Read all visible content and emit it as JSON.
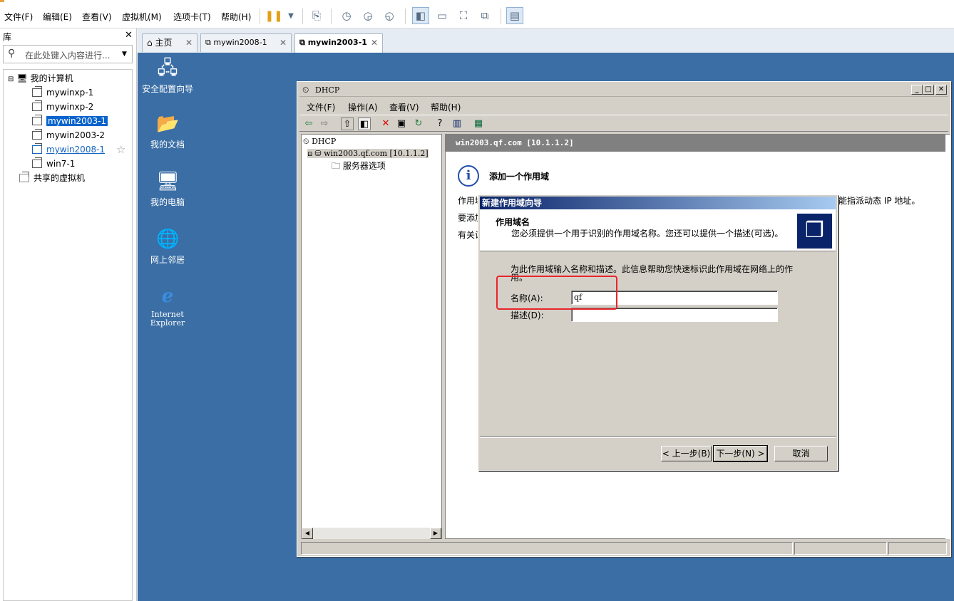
{
  "host": {
    "menu": [
      "文件(F)",
      "编辑(E)",
      "查看(V)",
      "虚拟机(M)",
      "选项卡(T)",
      "帮助(H)"
    ],
    "toolbar_icons": [
      "pause-icon",
      "dropdown-icon",
      "send-keys-icon",
      "snapshot-icon",
      "revert-snapshot-icon",
      "snapshot-manager-icon",
      "sidebar-toggle-icon",
      "console-view-icon",
      "fullscreen-icon",
      "unity-icon",
      "library-view-icon"
    ]
  },
  "library": {
    "title": "库",
    "search_placeholder": "在此处键入内容进行...",
    "root": "我的计算机",
    "vms": [
      "mywinxp-1",
      "mywinxp-2",
      "mywin2003-1",
      "mywin2003-2",
      "mywin2008-1",
      "win7-1"
    ],
    "selected": "mywin2003-1",
    "shared": "共享的虚拟机"
  },
  "tabs": [
    {
      "label": "主页"
    },
    {
      "label": "mywin2008-1"
    },
    {
      "label": "mywin2003-1"
    }
  ],
  "desktop": {
    "icons": [
      "安全配置向导",
      "我的文档",
      "我的电脑",
      "网上邻居",
      "Internet Explorer"
    ],
    "ie_line1": "Internet",
    "ie_line2": "Explorer"
  },
  "mmc": {
    "title": "DHCP",
    "menu": [
      "文件(F)",
      "操作(A)",
      "查看(V)",
      "帮助(H)"
    ],
    "tree_root": "DHCP",
    "tree_server": "win2003.qf.com [10.1.1.2]",
    "tree_child": "服务器选项",
    "right_header": "win2003.qf.com [10.1.1.2]",
    "right_title": "添加一个作用域",
    "right_line1": "作用域",
    "right_line1_tail": "能指派动态 IP 地址。",
    "right_line2": "要添加",
    "right_line3": "有关设"
  },
  "wizard": {
    "title": "新建作用域向导",
    "heading": "作用域名",
    "subheading": "您必须提供一个用于识别的作用域名称。您还可以提供一个描述(可选)。",
    "instruction": "为此作用域输入名称和描述。此信息帮助您快速标识此作用域在网络上的作用。",
    "name_label": "名称(A):",
    "name_value": "qf",
    "desc_label": "描述(D):",
    "desc_value": "",
    "back": "< 上一步(B)",
    "next": "下一步(N) >",
    "cancel": "取消"
  },
  "colors": {
    "guest_bg": "#3a6ea5",
    "highlight": "#e8262b",
    "selection": "#0a64ce"
  }
}
